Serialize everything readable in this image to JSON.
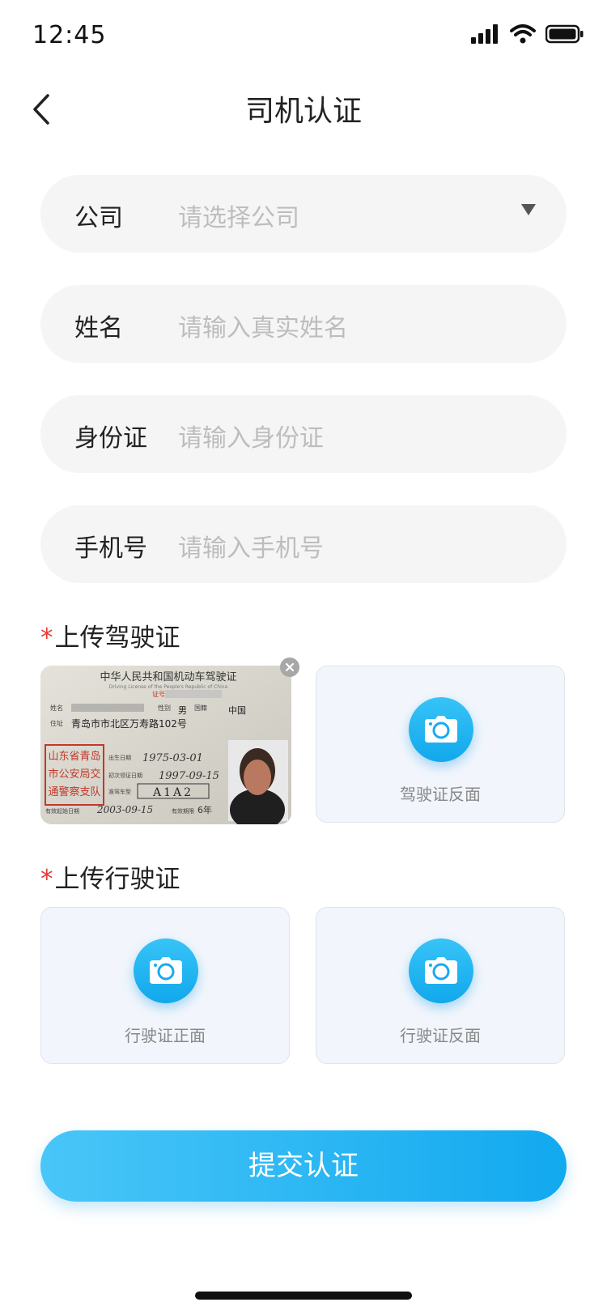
{
  "status_bar": {
    "time": "12:45",
    "icons": [
      "signal-icon",
      "wifi-icon",
      "battery-icon"
    ]
  },
  "nav": {
    "title": "司机认证",
    "back_icon": "chevron-left-icon"
  },
  "form": {
    "company": {
      "label": "公司",
      "placeholder": "请选择公司"
    },
    "name": {
      "label": "姓名",
      "placeholder": "请输入真实姓名"
    },
    "id_card": {
      "label": "身份证",
      "placeholder": "请输入身份证"
    },
    "phone": {
      "label": "手机号",
      "placeholder": "请输入手机号"
    }
  },
  "driver_license": {
    "required_mark": "*",
    "title": "上传驾驶证",
    "photo": {
      "header_cn": "中华人民共和国机动车驾驶证",
      "header_en": "Driving License of the People's Republic of China",
      "cert_no_label": "证号",
      "name_label": "姓名",
      "sex_label": "性别",
      "sex_value": "男",
      "nationality_label": "国籍",
      "nationality_value": "中国",
      "address_label": "住址",
      "address_value": "青岛市市北区万寿路102号",
      "dob_label": "出生日期",
      "dob_value": "1975-03-01",
      "issue_label": "初次领证日期",
      "issue_value": "1997-09-15",
      "class_label": "准驾车型",
      "class_value": "A1A2",
      "valid_label": "有效起始日期",
      "valid_value": "2003-09-15",
      "term_label": "有效期限",
      "term_value": "6年",
      "stamp_lines": [
        "山东省青岛",
        "市公安局交",
        "通警察支队"
      ]
    },
    "back_label": "驾驶证反面"
  },
  "vehicle_license": {
    "required_mark": "*",
    "title": "上传行驶证",
    "front_label": "行驶证正面",
    "back_label": "行驶证反面"
  },
  "submit_label": "提交认证",
  "colors": {
    "accent": "#1aaaf0",
    "required": "#e53935",
    "field_bg": "#f5f5f5",
    "card_bg": "#f2f6fc"
  }
}
